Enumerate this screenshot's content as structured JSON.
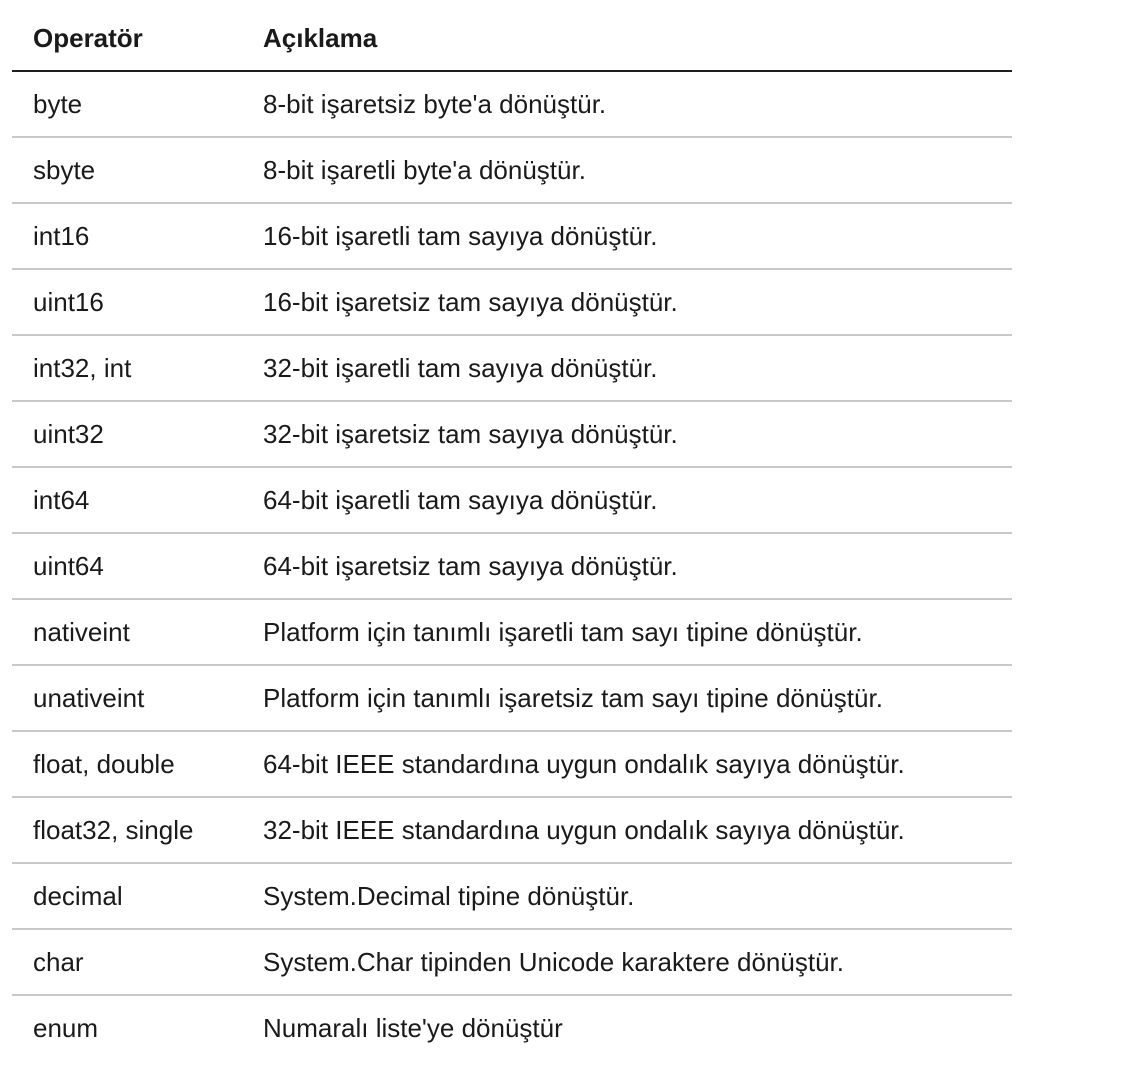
{
  "table": {
    "headers": [
      "Operatör",
      "Açıklama"
    ],
    "rows": [
      [
        "byte",
        "8-bit işaretsiz byte'a dönüştür."
      ],
      [
        "sbyte",
        "8-bit işaretli byte'a dönüştür."
      ],
      [
        "int16",
        "16-bit işaretli tam sayıya dönüştür."
      ],
      [
        "uint16",
        "16-bit işaretsiz tam sayıya dönüştür."
      ],
      [
        "int32, int",
        "32-bit işaretli tam sayıya dönüştür."
      ],
      [
        "uint32",
        "32-bit işaretsiz tam sayıya dönüştür."
      ],
      [
        "int64",
        "64-bit işaretli tam sayıya dönüştür."
      ],
      [
        "uint64",
        "64-bit işaretsiz tam sayıya dönüştür."
      ],
      [
        "nativeint",
        "Platform için tanımlı işaretli tam sayı tipine dönüştür."
      ],
      [
        "unativeint",
        "Platform için tanımlı işaretsiz tam sayı tipine dönüştür."
      ],
      [
        "float, double",
        "64-bit IEEE standardına uygun ondalık sayıya dönüştür."
      ],
      [
        "float32, single",
        "32-bit IEEE standardına uygun ondalık sayıya dönüştür."
      ],
      [
        "decimal",
        "System.Decimal tipine dönüştür."
      ],
      [
        "char",
        "System.Char tipinden Unicode karaktere dönüştür."
      ],
      [
        "enum",
        "Numaralı liste'ye dönüştür"
      ]
    ]
  }
}
